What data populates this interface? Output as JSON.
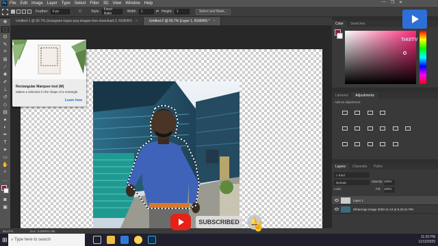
{
  "app": {
    "name": "Ps"
  },
  "menubar": {
    "items": [
      "File",
      "Edit",
      "Image",
      "Layer",
      "Type",
      "Select",
      "Filter",
      "3D",
      "View",
      "Window",
      "Help"
    ],
    "window_controls": [
      "—",
      "❐",
      "✕"
    ]
  },
  "options": {
    "feather_label": "Feather:",
    "feather_value": "0 px",
    "style_label": "Style:",
    "style_value": "Fixed Ratio",
    "width_label": "Width:",
    "width_value": "1",
    "height_label": "Height:",
    "height_value": "1",
    "select_mask_label": "Select and Mask..."
  },
  "tabs": [
    {
      "label": "Untitled-1 @ 66.7% (instagram-logos-png-images-free-download-2, RGB/8#)",
      "close": "×"
    },
    {
      "label": "Untitled-2 @ 66.7% (Layer 1, RGB/8#) *",
      "close": "×"
    }
  ],
  "tooltip": {
    "title": "Rectangular Marquee tool (M)",
    "desc": "Makes a selection in the shape of a rectangle",
    "link": "Learn how"
  },
  "status": {
    "zoom": "66.67%",
    "doc": "Doc: 3.00M/11.0M"
  },
  "color_panel": {
    "tabs": [
      "Color",
      "Swatches"
    ]
  },
  "libraries_panel": {
    "tabs": [
      "Libraries",
      "Adjustments"
    ],
    "add_label": "Add an adjustment"
  },
  "layers_panel": {
    "tabs": [
      "Layers",
      "Channels",
      "Paths"
    ],
    "kind": "Kind",
    "blend_mode": "Normal",
    "opacity_label": "Opacity:",
    "opacity_value": "100%",
    "lock_label": "Lock:",
    "fill_label": "Fill:",
    "fill_value": "100%",
    "layers": [
      "Layer 1",
      "WhatsApp Image 2020-11-13 at 8.25.01 PM"
    ]
  },
  "watermark": {
    "label": "TekliTV"
  },
  "subscribe": {
    "label": "SUBSCRIBED"
  },
  "taskbar": {
    "search_placeholder": "Type here to search",
    "time": "11:20 PM",
    "date": "11/12/2020"
  },
  "colors": {
    "accent": "#31a8ff",
    "fg_swatch": "#8b1a4b",
    "youtube_red": "#e62117"
  }
}
